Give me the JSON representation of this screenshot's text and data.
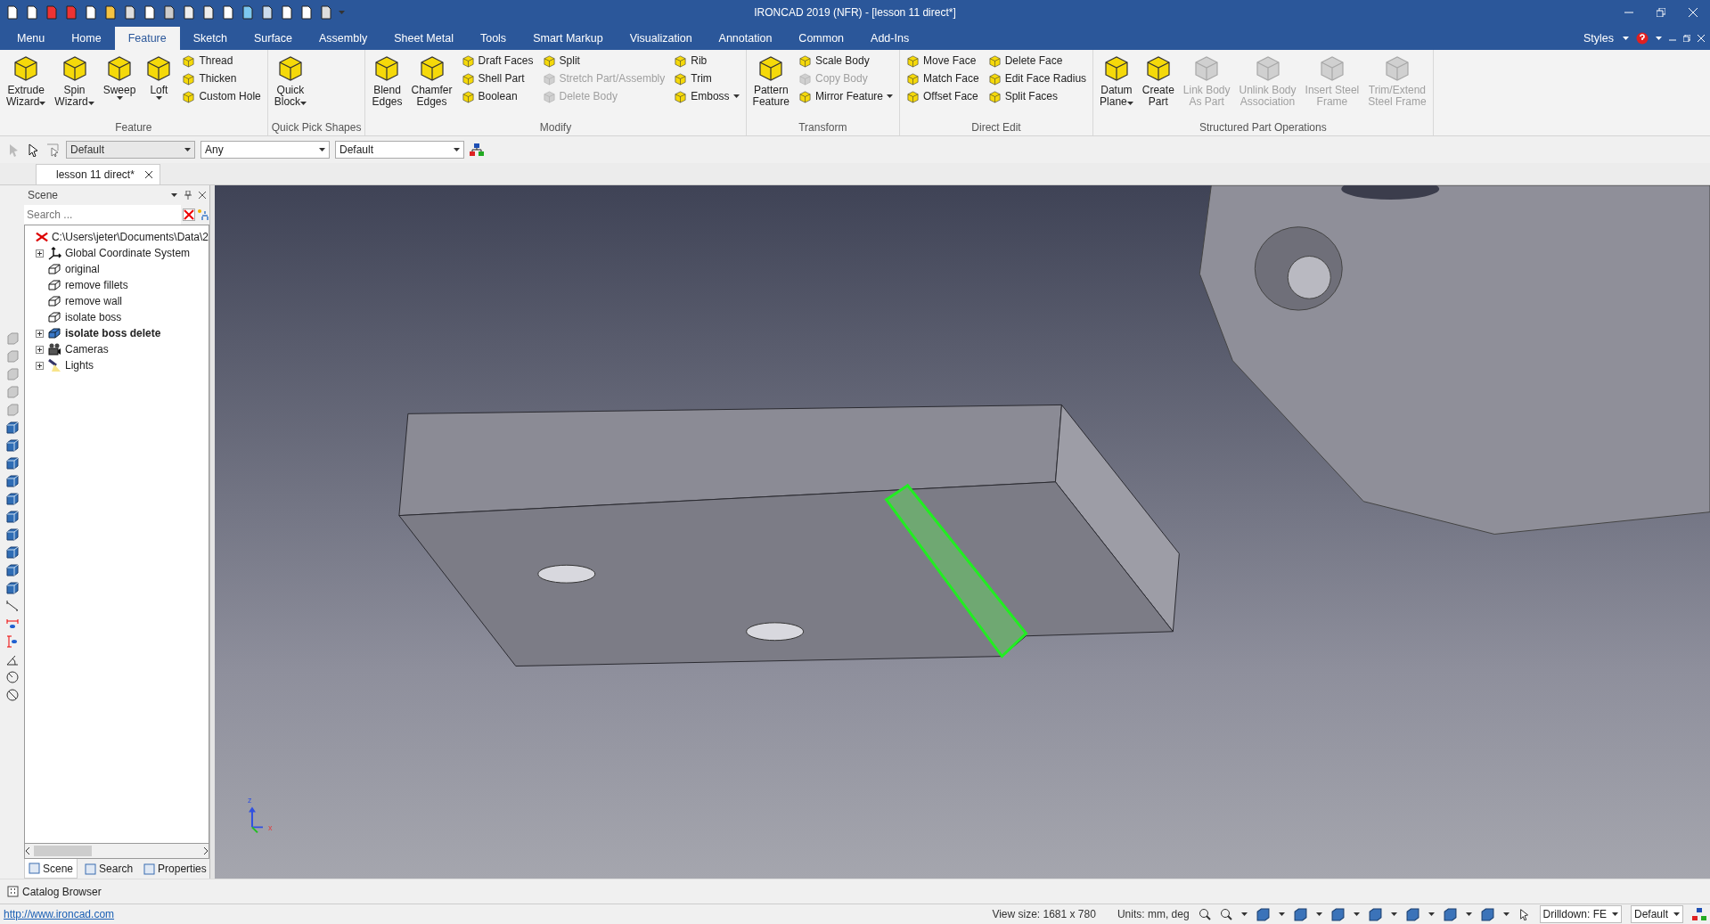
{
  "window": {
    "title": "IRONCAD 2019 (NFR) - [lesson 11 direct*]"
  },
  "ribbon_tabs": [
    {
      "label": "Menu",
      "selected": false
    },
    {
      "label": "Home",
      "selected": false
    },
    {
      "label": "Feature",
      "selected": true
    },
    {
      "label": "Sketch",
      "selected": false
    },
    {
      "label": "Surface",
      "selected": false
    },
    {
      "label": "Assembly",
      "selected": false
    },
    {
      "label": "Sheet Metal",
      "selected": false
    },
    {
      "label": "Tools",
      "selected": false
    },
    {
      "label": "Smart Markup",
      "selected": false
    },
    {
      "label": "Visualization",
      "selected": false
    },
    {
      "label": "Annotation",
      "selected": false
    },
    {
      "label": "Common",
      "selected": false
    },
    {
      "label": "Add-Ins",
      "selected": false
    }
  ],
  "styles_menu": "Styles",
  "ribbon_groups": [
    {
      "label": "Feature",
      "items": [
        {
          "kind": "large",
          "lines": [
            "Extrude",
            "Wizard"
          ],
          "dropdown": true,
          "disabled": false
        },
        {
          "kind": "large",
          "lines": [
            "Spin",
            "Wizard"
          ],
          "dropdown": true,
          "disabled": false
        },
        {
          "kind": "large",
          "lines": [
            "Sweep"
          ],
          "dropdown": true,
          "disabled": false
        },
        {
          "kind": "large",
          "lines": [
            "Loft"
          ],
          "dropdown": true,
          "disabled": false
        },
        {
          "kind": "stack",
          "items": [
            {
              "label": "Thread",
              "disabled": false,
              "dropdown": false
            },
            {
              "label": "Thicken",
              "disabled": false,
              "dropdown": false
            },
            {
              "label": "Custom Hole",
              "disabled": false,
              "dropdown": false
            }
          ]
        }
      ]
    },
    {
      "label": "Quick Pick Shapes",
      "items": [
        {
          "kind": "large",
          "lines": [
            "Quick",
            "Block"
          ],
          "dropdown": true,
          "disabled": false
        }
      ]
    },
    {
      "label": "Modify",
      "items": [
        {
          "kind": "large",
          "lines": [
            "Blend",
            "Edges"
          ],
          "dropdown": false,
          "disabled": false
        },
        {
          "kind": "large",
          "lines": [
            "Chamfer",
            "Edges"
          ],
          "dropdown": false,
          "disabled": false
        },
        {
          "kind": "stack",
          "items": [
            {
              "label": "Draft Faces",
              "disabled": false,
              "dropdown": false
            },
            {
              "label": "Shell Part",
              "disabled": false,
              "dropdown": false
            },
            {
              "label": "Boolean",
              "disabled": false,
              "dropdown": false
            }
          ]
        },
        {
          "kind": "stack",
          "items": [
            {
              "label": "Split",
              "disabled": false,
              "dropdown": false
            },
            {
              "label": "Stretch Part/Assembly",
              "disabled": true,
              "dropdown": false
            },
            {
              "label": "Delete Body",
              "disabled": true,
              "dropdown": false
            }
          ]
        },
        {
          "kind": "stack",
          "items": [
            {
              "label": "Rib",
              "disabled": false,
              "dropdown": false
            },
            {
              "label": "Trim",
              "disabled": false,
              "dropdown": false
            },
            {
              "label": "Emboss",
              "disabled": false,
              "dropdown": true
            }
          ]
        }
      ]
    },
    {
      "label": "Transform",
      "items": [
        {
          "kind": "large",
          "lines": [
            "Pattern",
            "Feature"
          ],
          "dropdown": false,
          "disabled": false
        },
        {
          "kind": "stack",
          "items": [
            {
              "label": "Scale Body",
              "disabled": false,
              "dropdown": false
            },
            {
              "label": "Copy Body",
              "disabled": true,
              "dropdown": false
            },
            {
              "label": "Mirror Feature",
              "disabled": false,
              "dropdown": true
            }
          ]
        }
      ]
    },
    {
      "label": "Direct Edit",
      "items": [
        {
          "kind": "stack",
          "items": [
            {
              "label": "Move Face",
              "disabled": false,
              "dropdown": false
            },
            {
              "label": "Match Face",
              "disabled": false,
              "dropdown": false
            },
            {
              "label": "Offset Face",
              "disabled": false,
              "dropdown": false
            }
          ]
        },
        {
          "kind": "stack",
          "items": [
            {
              "label": "Delete Face",
              "disabled": false,
              "dropdown": false
            },
            {
              "label": "Edit Face Radius",
              "disabled": false,
              "dropdown": false
            },
            {
              "label": "Split Faces",
              "disabled": false,
              "dropdown": false
            }
          ]
        }
      ]
    },
    {
      "label": "Structured Part Operations",
      "items": [
        {
          "kind": "large",
          "lines": [
            "Datum",
            "Plane"
          ],
          "dropdown": true,
          "disabled": false
        },
        {
          "kind": "large",
          "lines": [
            "Create",
            "Part"
          ],
          "dropdown": false,
          "disabled": false
        },
        {
          "kind": "large",
          "lines": [
            "Link Body",
            "As Part"
          ],
          "dropdown": false,
          "disabled": true
        },
        {
          "kind": "large",
          "lines": [
            "Unlink Body",
            "Association"
          ],
          "dropdown": false,
          "disabled": true
        },
        {
          "kind": "large",
          "lines": [
            "Insert Steel",
            "Frame"
          ],
          "dropdown": false,
          "disabled": true
        },
        {
          "kind": "large",
          "lines": [
            "Trim/Extend",
            "Steel Frame"
          ],
          "dropdown": false,
          "disabled": true
        }
      ]
    }
  ],
  "filter_bar": [
    {
      "value": "Default",
      "disabled": true
    },
    {
      "value": "Any",
      "disabled": false
    },
    {
      "value": "Default",
      "disabled": false
    }
  ],
  "document_tabs": [
    {
      "label": "lesson 11 direct*",
      "selected": true
    }
  ],
  "scene_panel": {
    "title": "Scene",
    "search": {
      "placeholder": "Search ..."
    },
    "tree": [
      {
        "label": "C:\\Users\\jeter\\Documents\\Data\\2",
        "kind": "scene",
        "active": false,
        "children": [
          {
            "label": "Global Coordinate System",
            "kind": "axes",
            "active": false,
            "expanded": false
          },
          {
            "label": "original",
            "kind": "part",
            "active": false
          },
          {
            "label": "remove fillets",
            "kind": "part",
            "active": false
          },
          {
            "label": "remove wall",
            "kind": "part",
            "active": false
          },
          {
            "label": "isolate boss",
            "kind": "part",
            "active": false
          },
          {
            "label": "isolate boss delete",
            "kind": "part-solid",
            "active": true,
            "expanded": false
          },
          {
            "label": "Cameras",
            "kind": "camera",
            "active": false,
            "expanded": false
          },
          {
            "label": "Lights",
            "kind": "light",
            "active": false,
            "expanded": false
          }
        ]
      }
    ],
    "tabs": [
      {
        "label": "Scene",
        "selected": true
      },
      {
        "label": "Search",
        "selected": false
      },
      {
        "label": "Properties",
        "selected": false
      }
    ]
  },
  "viewport": {
    "triad": {
      "z": "z",
      "x": "x"
    }
  },
  "catalog_browser": "Catalog Browser",
  "status_bar": {
    "link": "http://www.ironcad.com",
    "view_size": "View size: 1681 x  780",
    "units": "Units: mm, deg",
    "drilldown": "Drilldown: FE",
    "style": "Default"
  }
}
